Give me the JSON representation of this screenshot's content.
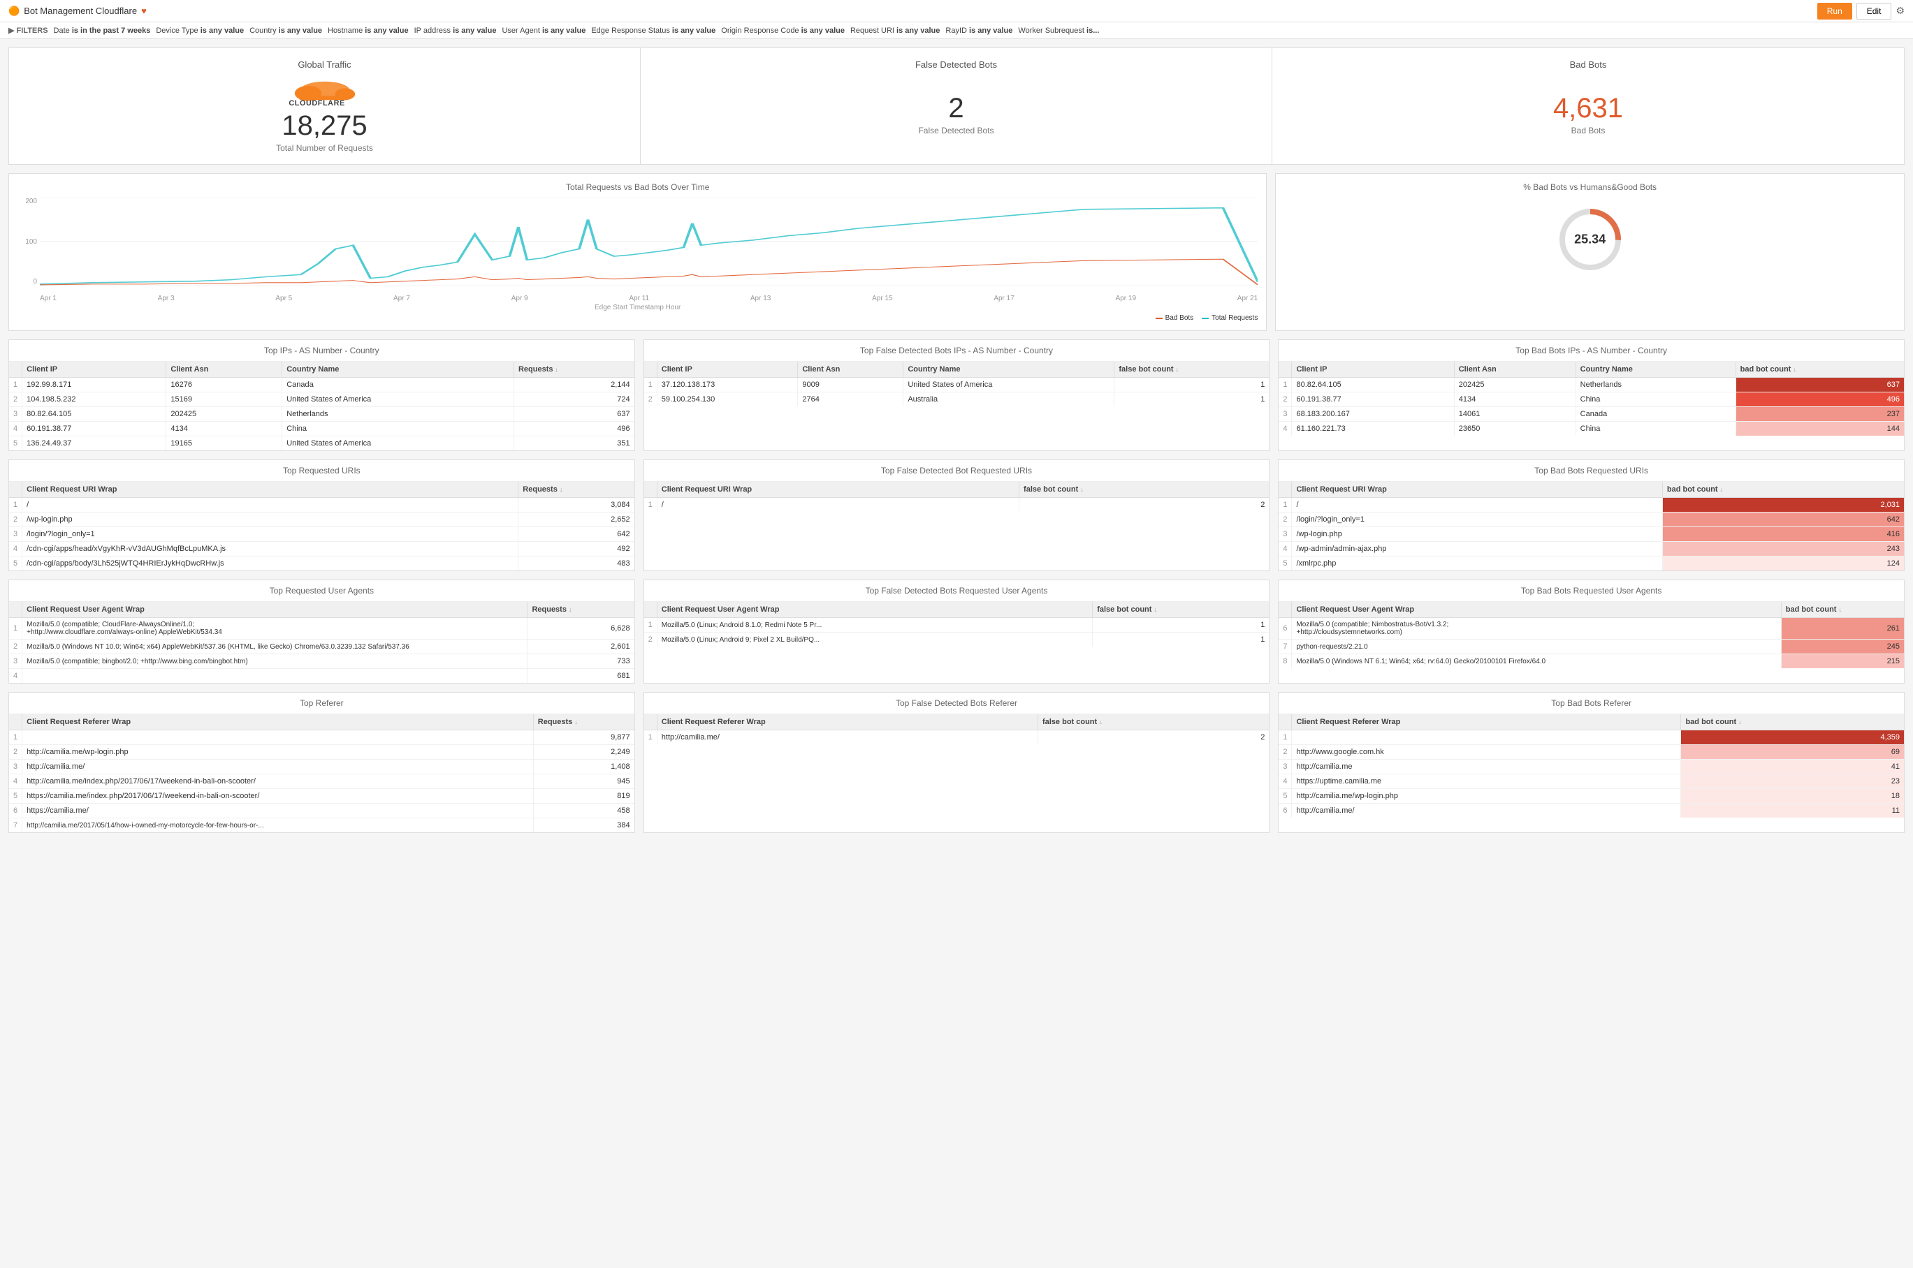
{
  "header": {
    "title": "Bot Management Cloudflare",
    "heart_icon": "♥",
    "run_label": "Run",
    "edit_label": "Edit",
    "settings_icon": "⚙"
  },
  "filters": {
    "toggle_label": "▶ FILTERS",
    "items": [
      {
        "label": "Date",
        "modifier": "is in the past 7 weeks"
      },
      {
        "label": "Device Type",
        "modifier": "is any value"
      },
      {
        "label": "Country",
        "modifier": "is any value"
      },
      {
        "label": "Hostname",
        "modifier": "is any value"
      },
      {
        "label": "IP address",
        "modifier": "is any value"
      },
      {
        "label": "User Agent",
        "modifier": "is any value"
      },
      {
        "label": "Edge Response Status",
        "modifier": "is any value"
      },
      {
        "label": "Origin Response Code",
        "modifier": "is any value"
      },
      {
        "label": "Request URI",
        "modifier": "is any value"
      },
      {
        "label": "RayID",
        "modifier": "is any value"
      },
      {
        "label": "Worker Subrequest",
        "modifier": "is..."
      }
    ]
  },
  "summary": {
    "global_traffic_label": "Global Traffic",
    "false_detected_label": "False Detected Bots",
    "bad_bots_label": "Bad Bots",
    "total_requests_number": "18,275",
    "total_requests_label": "Total Number of Requests",
    "false_detected_number": "2",
    "false_detected_sublabel": "False Detected Bots",
    "bad_bots_number": "4,631",
    "bad_bots_sublabel": "Bad Bots"
  },
  "chart": {
    "title": "Total Requests vs Bad Bots Over Time",
    "x_labels": [
      "Apr 1",
      "Apr 3",
      "Apr 5",
      "Apr 7",
      "Apr 9",
      "Apr 11",
      "Apr 13",
      "Apr 15",
      "Apr 17",
      "Apr 19",
      "Apr 21"
    ],
    "y_labels": [
      "200",
      "100",
      "0"
    ],
    "x_axis_label": "Edge Start Timestamp Hour",
    "legend": {
      "bad_bots": "Bad Bots",
      "total_requests": "Total Requests"
    }
  },
  "gauge": {
    "title": "% Bad Bots vs Humans&Good Bots",
    "value": "25.34",
    "percent": 25.34
  },
  "top_ips": {
    "title": "Top IPs - AS Number - Country",
    "headers": [
      "",
      "Client IP",
      "Client Asn",
      "Country Name",
      "Requests"
    ],
    "rows": [
      {
        "num": 1,
        "ip": "192.99.8.171",
        "asn": "16276",
        "country": "Canada",
        "requests": "2,144",
        "heat": 0
      },
      {
        "num": 2,
        "ip": "104.198.5.232",
        "asn": "15169",
        "country": "United States of America",
        "requests": "724",
        "heat": 0
      },
      {
        "num": 3,
        "ip": "80.82.64.105",
        "asn": "202425",
        "country": "Netherlands",
        "requests": "637",
        "heat": 0
      },
      {
        "num": 4,
        "ip": "60.191.38.77",
        "asn": "4134",
        "country": "China",
        "requests": "496",
        "heat": 0
      },
      {
        "num": 5,
        "ip": "136.24.49.37",
        "asn": "19165",
        "country": "United States of America",
        "requests": "351",
        "heat": 0
      }
    ]
  },
  "top_false_ips": {
    "title": "Top False Detected Bots IPs - AS Number - Country",
    "headers": [
      "",
      "Client IP",
      "Client Asn",
      "Country Name",
      "false bot count"
    ],
    "rows": [
      {
        "num": 1,
        "ip": "37.120.138.173",
        "asn": "9009",
        "country": "United States of America",
        "count": "1"
      },
      {
        "num": 2,
        "ip": "59.100.254.130",
        "asn": "2764",
        "country": "Australia",
        "count": "1"
      }
    ]
  },
  "top_bad_ips": {
    "title": "Top Bad Bots IPs - AS Number - Country",
    "headers": [
      "",
      "Client IP",
      "Client Asn",
      "Country Name",
      "bad bot count"
    ],
    "rows": [
      {
        "num": 1,
        "ip": "80.82.64.105",
        "asn": "202425",
        "country": "Netherlands",
        "count": "637",
        "heat": 5
      },
      {
        "num": 2,
        "ip": "60.191.38.77",
        "asn": "4134",
        "country": "China",
        "count": "496",
        "heat": 4
      },
      {
        "num": 3,
        "ip": "68.183.200.167",
        "asn": "14061",
        "country": "Canada",
        "count": "237",
        "heat": 3
      },
      {
        "num": 4,
        "ip": "61.160.221.73",
        "asn": "23650",
        "country": "China",
        "count": "144",
        "heat": 2
      }
    ]
  },
  "top_uris": {
    "title": "Top Requested URIs",
    "headers": [
      "",
      "Client Request URI Wrap",
      "Requests"
    ],
    "rows": [
      {
        "num": 1,
        "uri": "/",
        "requests": "3,084"
      },
      {
        "num": 2,
        "uri": "/wp-login.php",
        "requests": "2,652"
      },
      {
        "num": 3,
        "uri": "/login/?login_only=1",
        "requests": "642"
      },
      {
        "num": 4,
        "uri": "/cdn-cgi/apps/head/xVgyKhR-vV3dAUGhMqfBcLpuMKA.js",
        "requests": "492"
      },
      {
        "num": 5,
        "uri": "/cdn-cgi/apps/body/3Lh525jWTQ4HRIErJykHqDwcRHw.js",
        "requests": "483"
      }
    ]
  },
  "top_false_uris": {
    "title": "Top False Detected Bot Requested URIs",
    "headers": [
      "",
      "Client Request URI Wrap",
      "false bot count"
    ],
    "rows": [
      {
        "num": 1,
        "uri": "/",
        "count": "2"
      }
    ]
  },
  "top_bad_uris": {
    "title": "Top Bad Bots Requested URIs",
    "headers": [
      "",
      "Client Request URI Wrap",
      "bad bot count"
    ],
    "rows": [
      {
        "num": 1,
        "uri": "/",
        "count": "2,031",
        "heat": 5
      },
      {
        "num": 2,
        "uri": "/login/?login_only=1",
        "count": "642",
        "heat": 3
      },
      {
        "num": 3,
        "uri": "/wp-login.php",
        "count": "416",
        "heat": 3
      },
      {
        "num": 4,
        "uri": "/wp-admin/admin-ajax.php",
        "count": "243",
        "heat": 2
      },
      {
        "num": 5,
        "uri": "/xmlrpc.php",
        "count": "124",
        "heat": 1
      }
    ]
  },
  "top_agents": {
    "title": "Top Requested User Agents",
    "headers": [
      "",
      "Client Request User Agent Wrap",
      "Requests"
    ],
    "rows": [
      {
        "num": 1,
        "agent": "Mozilla/5.0 (compatible; CloudFlare-AlwaysOnline/1.0; +http://www.cloudflare.com/always-online) AppleWebKit/534.34",
        "requests": "6,628"
      },
      {
        "num": 2,
        "agent": "Mozilla/5.0 (Windows NT 10.0; Win64; x64) AppleWebKit/537.36 (KHTML, like Gecko) Chrome/63.0.3239.132 Safari/537.36",
        "requests": "2,601"
      },
      {
        "num": 3,
        "agent": "Mozilla/5.0 (compatible; bingbot/2.0; +http://www.bing.com/bingbot.htm)",
        "requests": "733"
      },
      {
        "num": 4,
        "agent": "",
        "requests": "681"
      }
    ]
  },
  "top_false_agents": {
    "title": "Top False Detected Bots Requested User Agents",
    "headers": [
      "",
      "Client Request User Agent Wrap",
      "false bot count"
    ],
    "rows": [
      {
        "num": 1,
        "agent": "Mozilla/5.0 (Linux; Android 8.1.0; Redmi Note 5 Pr...",
        "count": "1"
      },
      {
        "num": 2,
        "agent": "Mozilla/5.0 (Linux; Android 9; Pixel 2 XL Build/PQ...",
        "count": "1"
      }
    ]
  },
  "top_bad_agents": {
    "title": "Top Bad Bots Requested User Agents",
    "headers": [
      "",
      "Client Request User Agent Wrap",
      "bad bot count"
    ],
    "rows": [
      {
        "num": 6,
        "agent": "Mozilla/5.0 (compatible; Nimbostratus-Bot/v1.3.2; +http://cloudsystemnetworks.com)",
        "count": "261",
        "heat": 3
      },
      {
        "num": 7,
        "agent": "python-requests/2.21.0",
        "count": "245",
        "heat": 3
      },
      {
        "num": 8,
        "agent": "Mozilla/5.0 (Windows NT 6.1; Win64; x64; rv:64.0) Gecko/20100101 Firefox/64.0",
        "count": "215",
        "heat": 2
      }
    ]
  },
  "top_referer": {
    "title": "Top Referer",
    "headers": [
      "",
      "Client Request Referer Wrap",
      "Requests"
    ],
    "rows": [
      {
        "num": 1,
        "referer": "",
        "requests": "9,877"
      },
      {
        "num": 2,
        "referer": "http://camilia.me/wp-login.php",
        "requests": "2,249"
      },
      {
        "num": 3,
        "referer": "http://camilia.me/",
        "requests": "1,408"
      },
      {
        "num": 4,
        "referer": "http://camilia.me/index.php/2017/06/17/weekend-in-bali-on-scooter/",
        "requests": "945"
      },
      {
        "num": 5,
        "referer": "https://camilia.me/index.php/2017/06/17/weekend-in-bali-on-scooter/",
        "requests": "819"
      },
      {
        "num": 6,
        "referer": "https://camilia.me/",
        "requests": "458"
      },
      {
        "num": 7,
        "referer": "http://camilia.me/2017/05/14/how-i-owned-my-motorcycle-for-few-hours-or-...",
        "requests": "384"
      }
    ]
  },
  "top_false_referer": {
    "title": "Top False Detected Bots Referer",
    "headers": [
      "",
      "Client Request Referer Wrap",
      "false bot count"
    ],
    "rows": [
      {
        "num": 1,
        "referer": "http://camilia.me/",
        "count": "2"
      }
    ]
  },
  "top_bad_referer": {
    "title": "Top Bad Bots Referer",
    "headers": [
      "",
      "Client Request Referer Wrap",
      "bad bot count"
    ],
    "rows": [
      {
        "num": 1,
        "referer": "",
        "count": "4,359",
        "heat": 5
      },
      {
        "num": 2,
        "referer": "http://www.google.com.hk",
        "count": "69",
        "heat": 2
      },
      {
        "num": 3,
        "referer": "http://camilia.me",
        "count": "41",
        "heat": 1
      },
      {
        "num": 4,
        "referer": "https://uptime.camilia.me",
        "count": "23",
        "heat": 1
      },
      {
        "num": 5,
        "referer": "http://camilia.me/wp-login.php",
        "count": "18",
        "heat": 1
      },
      {
        "num": 6,
        "referer": "http://camilia.me/",
        "count": "11",
        "heat": 1
      }
    ]
  }
}
